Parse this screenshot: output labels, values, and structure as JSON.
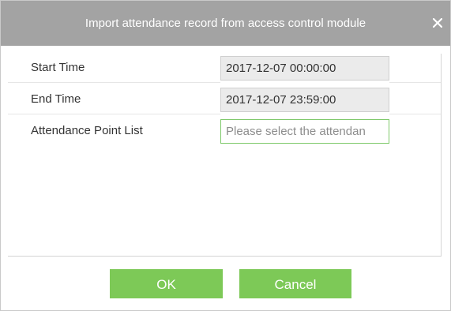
{
  "dialog": {
    "title": "Import attendance record from access control module",
    "close_icon": "close-icon"
  },
  "form": {
    "start_time_label": "Start Time",
    "start_time_value": "2017-12-07 00:00:00",
    "end_time_label": "End Time",
    "end_time_value": "2017-12-07 23:59:00",
    "attendance_point_label": "Attendance Point List",
    "attendance_point_placeholder": "Please select the attendan"
  },
  "buttons": {
    "ok_label": "OK",
    "cancel_label": "Cancel"
  },
  "colors": {
    "titlebar": "#a3a3a3",
    "button_green": "#7dc957",
    "field_bg": "#ebebeb"
  }
}
